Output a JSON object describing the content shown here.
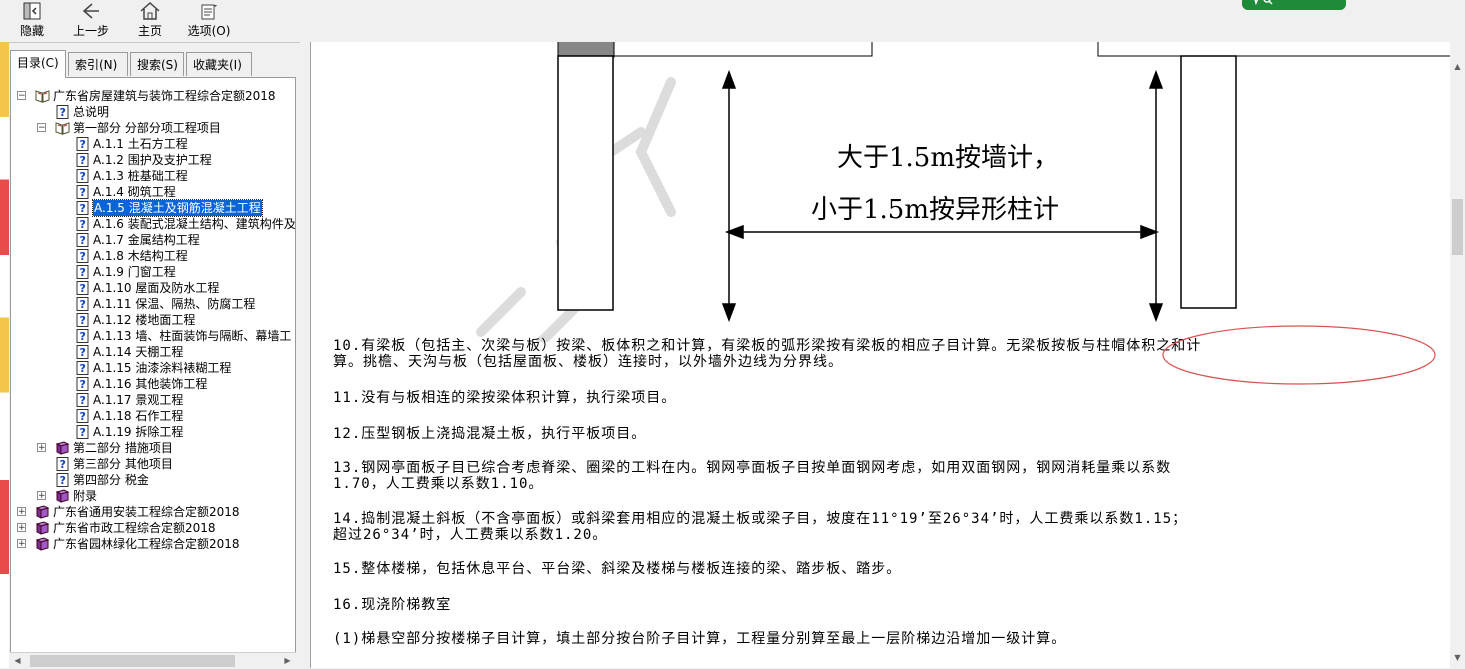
{
  "toolbar": {
    "hide_label": "隐藏",
    "back_label": "上一步",
    "home_label": "主页",
    "options_label": "选项(O)"
  },
  "tabs": [
    {
      "label": "目录(C)"
    },
    {
      "label": "索引(N)"
    },
    {
      "label": "搜索(S)"
    },
    {
      "label": "收藏夹(I)"
    }
  ],
  "tree": [
    {
      "text": "广东省房屋建筑与装饰工程综合定额2018",
      "icon": "book-open-icon",
      "level": 0,
      "toggle": "minus"
    },
    {
      "text": "总说明",
      "icon": "help-page-icon",
      "level": 1
    },
    {
      "text": "第一部分 分部分项工程项目",
      "icon": "book-open-icon",
      "level": 1,
      "toggle": "minus"
    },
    {
      "text": "A.1.1 土石方工程",
      "icon": "help-page-icon",
      "level": 2
    },
    {
      "text": "A.1.2 围护及支护工程",
      "icon": "help-page-icon",
      "level": 2
    },
    {
      "text": "A.1.3 桩基础工程",
      "icon": "help-page-icon",
      "level": 2
    },
    {
      "text": "A.1.4 砌筑工程",
      "icon": "help-page-icon",
      "level": 2
    },
    {
      "text": "A.1.5 混凝土及钢筋混凝土工程",
      "icon": "help-page-icon",
      "level": 2,
      "selected": true
    },
    {
      "text": "A.1.6 装配式混凝土结构、建筑构件及",
      "icon": "help-page-icon",
      "level": 2
    },
    {
      "text": "A.1.7 金属结构工程",
      "icon": "help-page-icon",
      "level": 2
    },
    {
      "text": "A.1.8 木结构工程",
      "icon": "help-page-icon",
      "level": 2
    },
    {
      "text": "A.1.9 门窗工程",
      "icon": "help-page-icon",
      "level": 2
    },
    {
      "text": "A.1.10 屋面及防水工程",
      "icon": "help-page-icon",
      "level": 2
    },
    {
      "text": "A.1.11 保温、隔热、防腐工程",
      "icon": "help-page-icon",
      "level": 2
    },
    {
      "text": "A.1.12 楼地面工程",
      "icon": "help-page-icon",
      "level": 2
    },
    {
      "text": "A.1.13 墙、柱面装饰与隔断、幕墙工",
      "icon": "help-page-icon",
      "level": 2
    },
    {
      "text": "A.1.14 天棚工程",
      "icon": "help-page-icon",
      "level": 2
    },
    {
      "text": "A.1.15 油漆涂料裱糊工程",
      "icon": "help-page-icon",
      "level": 2
    },
    {
      "text": "A.1.16 其他装饰工程",
      "icon": "help-page-icon",
      "level": 2
    },
    {
      "text": "A.1.17 景观工程",
      "icon": "help-page-icon",
      "level": 2
    },
    {
      "text": "A.1.18 石作工程",
      "icon": "help-page-icon",
      "level": 2
    },
    {
      "text": "A.1.19 拆除工程",
      "icon": "help-page-icon",
      "level": 2
    },
    {
      "text": "第二部分 措施项目",
      "icon": "book-closed-icon",
      "level": 1,
      "toggle": "plus"
    },
    {
      "text": "第三部分 其他项目",
      "icon": "help-page-icon",
      "level": 1
    },
    {
      "text": "第四部分 税金",
      "icon": "help-page-icon",
      "level": 1
    },
    {
      "text": "附录",
      "icon": "book-closed-icon",
      "level": 1,
      "toggle": "plus"
    },
    {
      "text": "广东省通用安装工程综合定额2018",
      "icon": "book-closed-icon",
      "level": 0,
      "toggle": "plus"
    },
    {
      "text": "广东省市政工程综合定额2018",
      "icon": "book-closed-icon",
      "level": 0,
      "toggle": "plus"
    },
    {
      "text": "广东省园林绿化工程综合定额2018",
      "icon": "book-closed-icon",
      "level": 0,
      "toggle": "plus"
    }
  ],
  "figure": {
    "line1": "大于1.5m按墙计，",
    "line2": "小于1.5m按异形柱计"
  },
  "paragraphs": [
    {
      "lines": [
        "10.有梁板（包括主、次梁与板）按梁、板体积之和计算，有梁板的弧形梁按有梁板的相应子目计算。无梁板按板与柱帽体积之和计",
        "算。挑檐、天沟与板（包括屋面板、楼板）连接时，以外墙外边线为分界线。"
      ]
    },
    {
      "lines": [
        "11.没有与板相连的梁按梁体积计算，执行梁项目。"
      ]
    },
    {
      "lines": [
        "12.压型钢板上浇捣混凝土板，执行平板项目。"
      ]
    },
    {
      "lines": [
        "13.钢网亭面板子目已综合考虑脊梁、圈梁的工料在内。钢网亭面板子目按单面钢网考虑，如用双面钢网，钢网消耗量乘以系数",
        "1.70，人工费乘以系数1.10。"
      ]
    },
    {
      "lines": [
        "14.捣制混凝土斜板（不含亭面板）或斜梁套用相应的混凝土板或梁子目，坡度在11°19’至26°34’时，人工费乘以系数1.15；",
        "超过26°34’时，人工费乘以系数1.20。"
      ]
    },
    {
      "lines": [
        "15.整体楼梯，包括休息平台、平台梁、斜梁及楼梯与楼板连接的梁、踏步板、踏步。"
      ]
    },
    {
      "lines": [
        "16.现浇阶梯教室"
      ]
    },
    {
      "lines": [
        "(1)梯悬空部分按楼梯子目计算，填土部分按台阶子目计算，工程量分别算至最上一层阶梯边沿增加一级计算。"
      ]
    }
  ],
  "colors": {
    "selection": "#0a64d8",
    "annotation_circle": "#d9534f",
    "brand": "#1f8a3a"
  }
}
